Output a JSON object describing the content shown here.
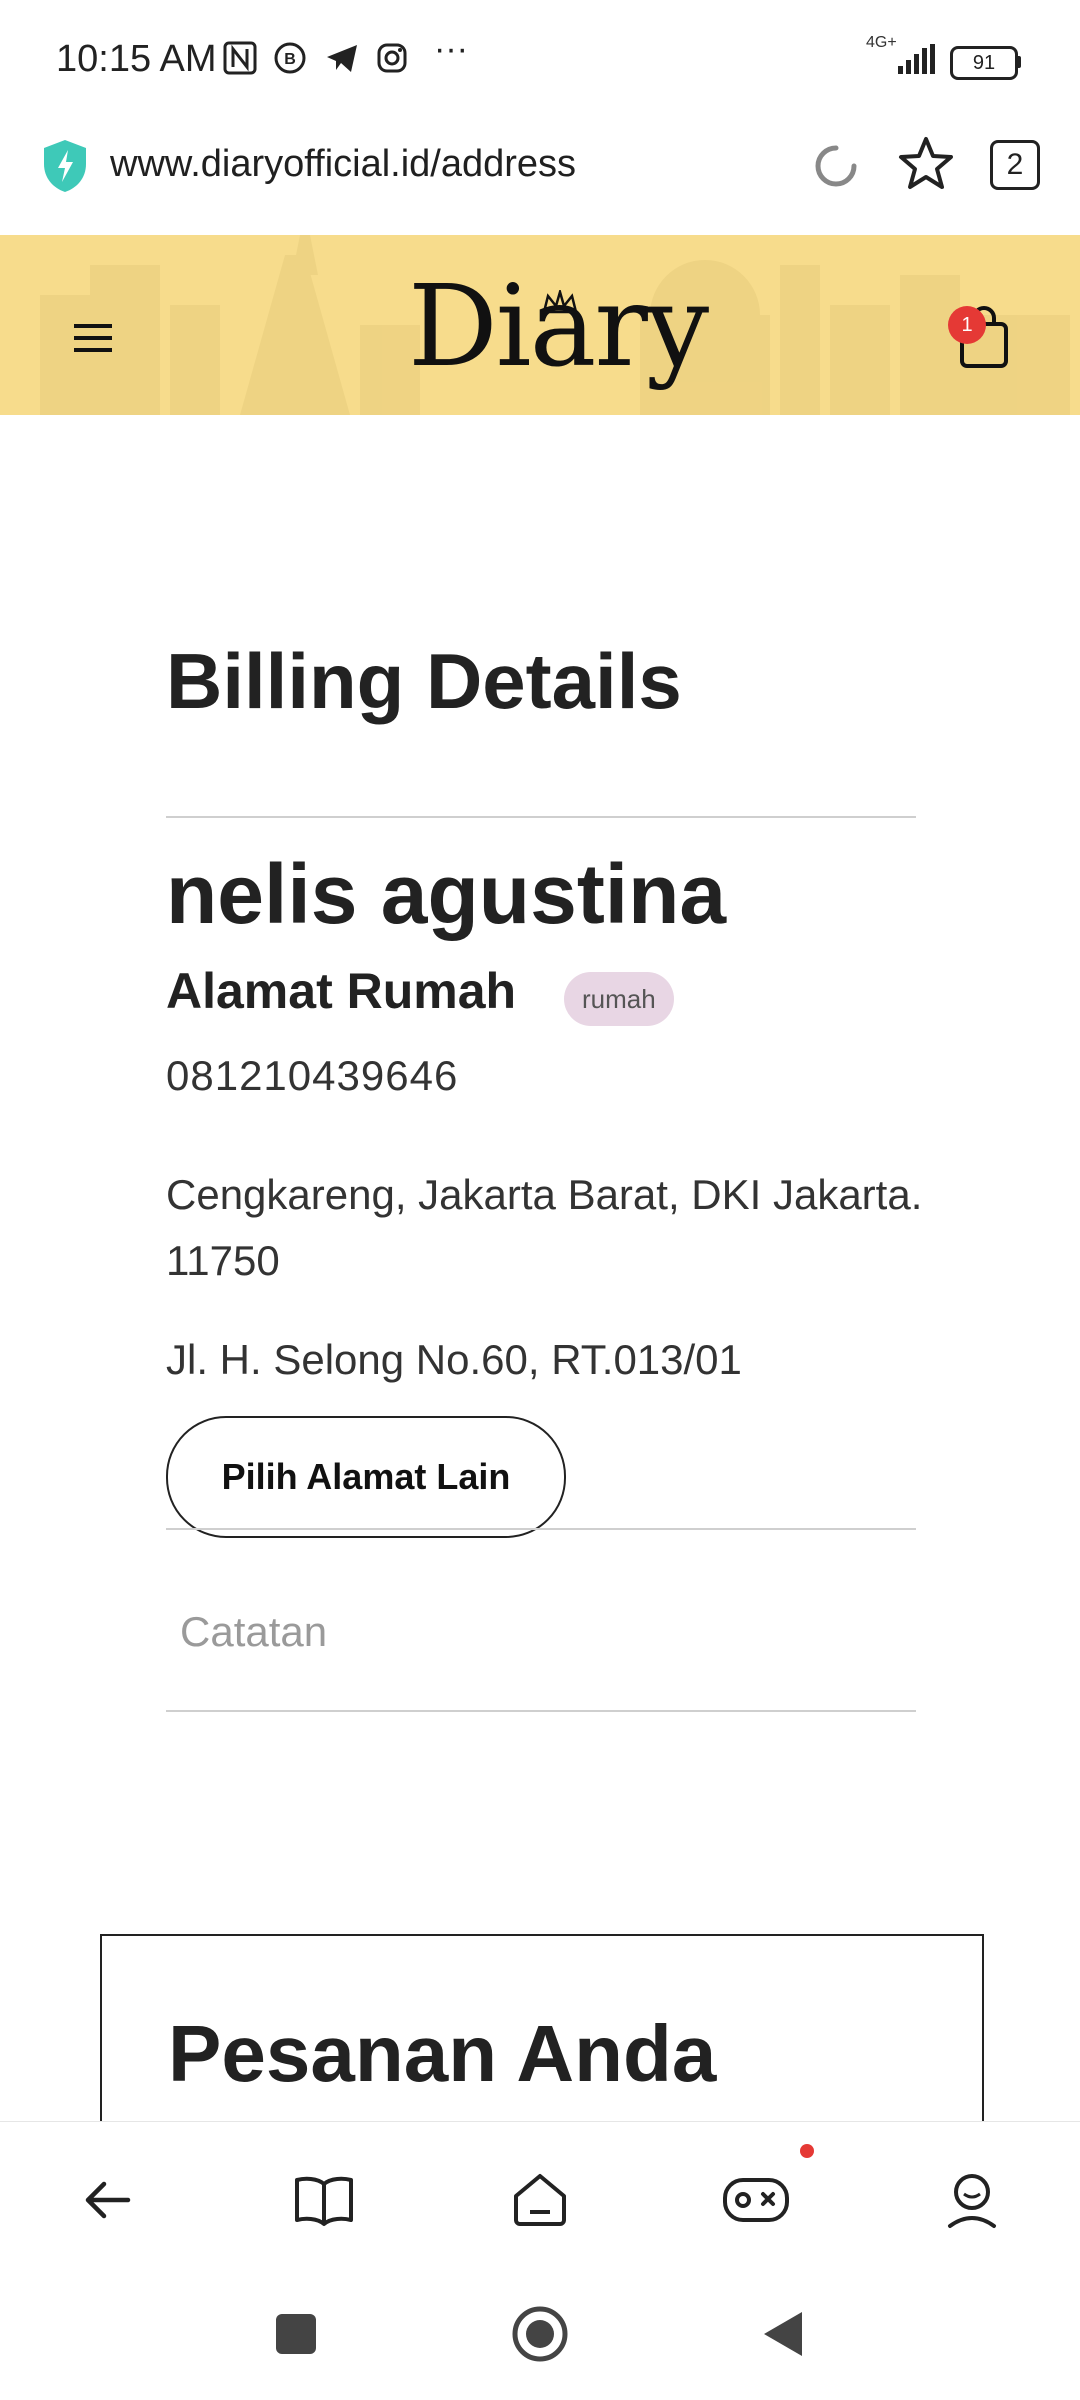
{
  "status_bar": {
    "time": "10:15 AM",
    "network": "4G+",
    "battery": "91",
    "more": "···"
  },
  "browser": {
    "url": "www.diaryofficial.id/address",
    "tab_count": "2"
  },
  "header": {
    "brand": "Diary",
    "cart_count": "1"
  },
  "billing": {
    "title": "Billing Details",
    "name": "nelis agustina",
    "address_label": "Alamat Rumah",
    "address_tag": "rumah",
    "phone": "081210439646",
    "region": "Cengkareng, Jakarta Barat, DKI Jakarta. 11750",
    "street": "Jl. H. Selong No.60, RT.013/01",
    "change_button": "Pilih Alamat Lain",
    "notes_placeholder": "Catatan"
  },
  "orders": {
    "title": "Pesanan Anda"
  },
  "icons": {
    "status": [
      "nfc-icon",
      "chat-b-icon",
      "telegram-icon",
      "instagram-icon"
    ],
    "browser": [
      "shield-icon",
      "reload-icon",
      "star-icon"
    ],
    "header": [
      "menu-icon",
      "shopping-bag-icon"
    ],
    "bottom_nav": [
      "back-arrow-icon",
      "book-icon",
      "home-icon",
      "gamepad-icon",
      "profile-icon"
    ],
    "system_nav": [
      "recents-icon",
      "home-circle-icon",
      "back-triangle-icon"
    ]
  },
  "colors": {
    "header_bg": "#f7dc8c",
    "tag_bg": "#e8d6e4",
    "badge_red": "#e53935",
    "shield_teal": "#3ec9b8"
  }
}
